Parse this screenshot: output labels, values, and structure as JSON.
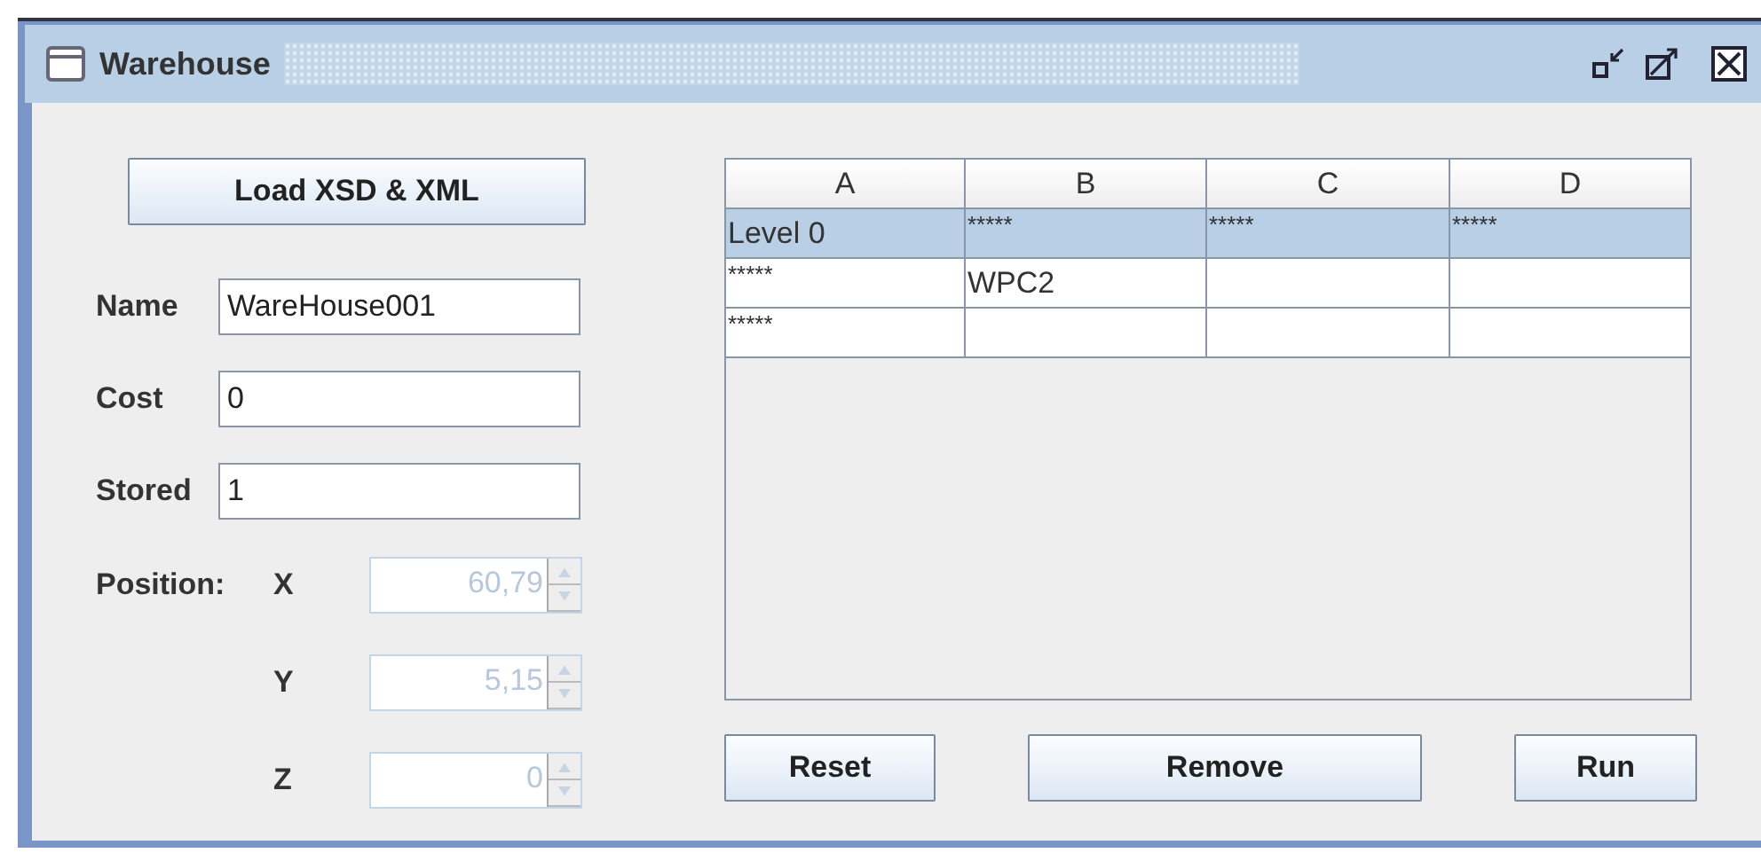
{
  "window": {
    "title": "Warehouse"
  },
  "load_button": "Load XSD & XML",
  "fields": [
    {
      "label": "Name",
      "value": "WareHouse001"
    },
    {
      "label": "Cost",
      "value": "0"
    },
    {
      "label": "Stored",
      "value": "1"
    }
  ],
  "position": {
    "label": "Position:",
    "axes": [
      {
        "label": "X",
        "value": "60,79",
        "disabled": true
      },
      {
        "label": "Y",
        "value": "5,15",
        "disabled": true
      },
      {
        "label": "Z",
        "value": "0",
        "disabled": true
      }
    ]
  },
  "table": {
    "columns": [
      "A",
      "B",
      "C",
      "D"
    ],
    "rows": [
      {
        "selected": true,
        "cells": [
          "Level 0",
          "*****",
          "*****",
          "*****"
        ]
      },
      {
        "selected": false,
        "cells": [
          "*****",
          "WPC2",
          "",
          ""
        ]
      },
      {
        "selected": false,
        "cells": [
          "*****",
          "",
          "",
          ""
        ]
      }
    ]
  },
  "buttons": [
    "Reset",
    "Remove",
    "Run"
  ]
}
